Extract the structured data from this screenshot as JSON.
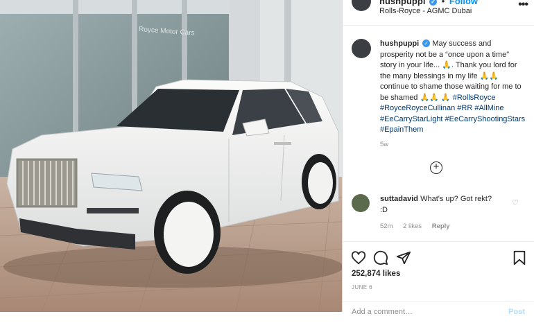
{
  "header": {
    "username": "hushpuppi",
    "verified_glyph": "✓",
    "separator": "•",
    "follow_label": "Follow",
    "location": "Rolls-Royce - AGMC Dubai",
    "more_icon": "more-icon"
  },
  "caption": {
    "username": "hushpuppi",
    "text": "May success and prosperity not be a “once upon a time” story in your life... 🙏. Thank you lord for the many blessings in my life 🙏🙏 continue to shame those waiting for me to be shamed 🙏🙏 🙏",
    "hashtags": "#RollsRoyce #RoyceRoyceCullinan #RR #AllMine #EeCarryStarLight #EeCarryShootingStars #EpainThem",
    "time": "5w"
  },
  "load_more_glyph": "+",
  "comment": {
    "username": "suttadavid",
    "text": "What's up? Got rekt? :D",
    "time": "52m",
    "likes": "2 likes",
    "reply": "Reply"
  },
  "actions": {
    "likes_count": "252,874 likes",
    "date": "JUNE 6"
  },
  "add_comment": {
    "placeholder": "Add a comment…",
    "post_label": "Post"
  },
  "photo": {
    "subject": "White Rolls-Royce Cullinan parked in front of a glass showroom",
    "sign_text": "Royce Motor Cars",
    "colors": {
      "car": "#f3f3f1",
      "ground": "#b89a86",
      "wall": "#c9ced2"
    }
  }
}
